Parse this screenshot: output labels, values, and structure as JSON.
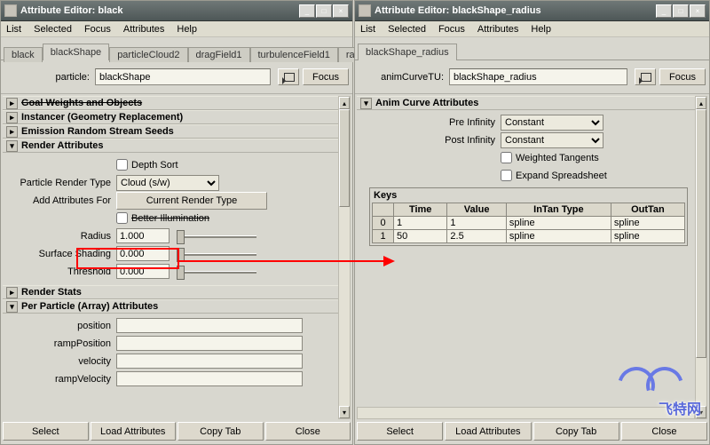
{
  "window1": {
    "title": "Attribute Editor: black",
    "menu": [
      "List",
      "Selected",
      "Focus",
      "Attributes",
      "Help"
    ],
    "tabs": [
      "black",
      "blackShape",
      "particleCloud2",
      "dragField1",
      "turbulenceField1",
      "radiu"
    ],
    "activeTab": 1,
    "form": {
      "label": "particle:",
      "value": "blackShape",
      "focus": "Focus"
    },
    "sections": {
      "goal": "Goal Weights and Objects",
      "instancer": "Instancer (Geometry Replacement)",
      "emission": "Emission Random Stream Seeds",
      "renderAttrs": "Render Attributes",
      "renderStats": "Render Stats",
      "perParticle": "Per Particle (Array) Attributes"
    },
    "render": {
      "depthSort": "Depth Sort",
      "particleRenderType_lbl": "Particle Render Type",
      "particleRenderType_val": "Cloud (s/w)",
      "addAttrsFor_lbl": "Add Attributes For",
      "currentRenderType": "Current Render Type",
      "betterIllum": "Better Illumination",
      "radius_lbl": "Radius",
      "radius_val": "1.000",
      "surfaceShading_lbl": "Surface Shading",
      "surfaceShading_val": "0.000",
      "threshold_lbl": "Threshold",
      "threshold_val": "0.000"
    },
    "perParticleRows": [
      "position",
      "rampPosition",
      "velocity",
      "rampVelocity"
    ],
    "bottom": [
      "Select",
      "Load Attributes",
      "Copy Tab",
      "Close"
    ]
  },
  "window2": {
    "title": "Attribute Editor: blackShape_radius",
    "menu": [
      "List",
      "Selected",
      "Focus",
      "Attributes",
      "Help"
    ],
    "tabs": [
      "blackShape_radius"
    ],
    "form": {
      "label": "animCurveTU:",
      "value": "blackShape_radius",
      "focus": "Focus"
    },
    "animCurve": {
      "header": "Anim Curve Attributes",
      "preInf_lbl": "Pre Infinity",
      "preInf_val": "Constant",
      "postInf_lbl": "Post Infinity",
      "postInf_val": "Constant",
      "weighted": "Weighted Tangents",
      "expand": "Expand Spreadsheet"
    },
    "keys": {
      "label": "Keys",
      "cols": [
        "",
        "Time",
        "Value",
        "InTan Type",
        "OutTan"
      ],
      "rows": [
        {
          "i": "0",
          "time": "1",
          "value": "1",
          "intan": "spline",
          "outtan": "spline"
        },
        {
          "i": "1",
          "time": "50",
          "value": "2.5",
          "intan": "spline",
          "outtan": "spline"
        }
      ]
    },
    "bottom": [
      "Select",
      "Load Attributes",
      "Copy Tab",
      "Close"
    ]
  },
  "logoText": "飞特网"
}
